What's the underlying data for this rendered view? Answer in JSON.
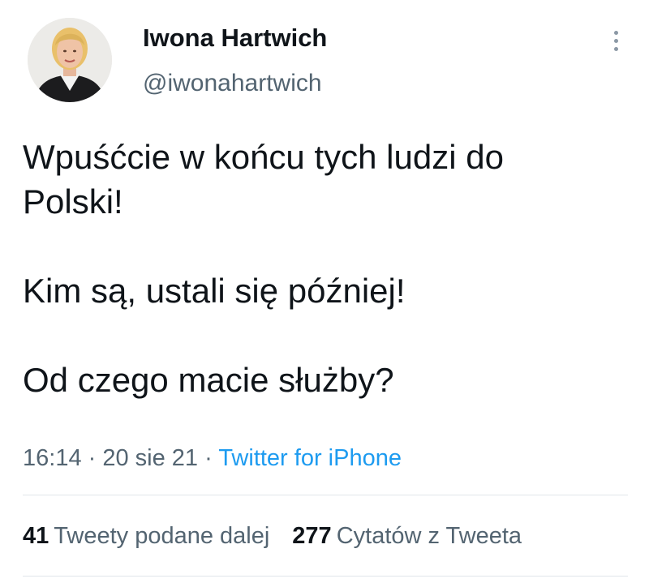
{
  "author": {
    "display_name": "Iwona Hartwich",
    "handle": "@iwonahartwich"
  },
  "tweet": {
    "paragraphs": [
      "Wpuśćcie w końcu tych ludzi do\nPolski!",
      "Kim są, ustali się później!",
      "Od czego macie służby?"
    ]
  },
  "meta": {
    "time": "16:14",
    "separator_1": " · ",
    "date": "20 sie 21",
    "separator_2": " · ",
    "source": "Twitter for iPhone"
  },
  "stats": {
    "retweets_count": "41",
    "retweets_label": "Tweety podane dalej",
    "quotes_count": "277",
    "quotes_label": "Cytatów z Tweeta"
  },
  "icons": {
    "more": "more-vertical-icon"
  },
  "colors": {
    "text": "#0f1419",
    "secondary": "#536471",
    "link": "#1d9bf0",
    "divider": "#e1e6ea"
  }
}
